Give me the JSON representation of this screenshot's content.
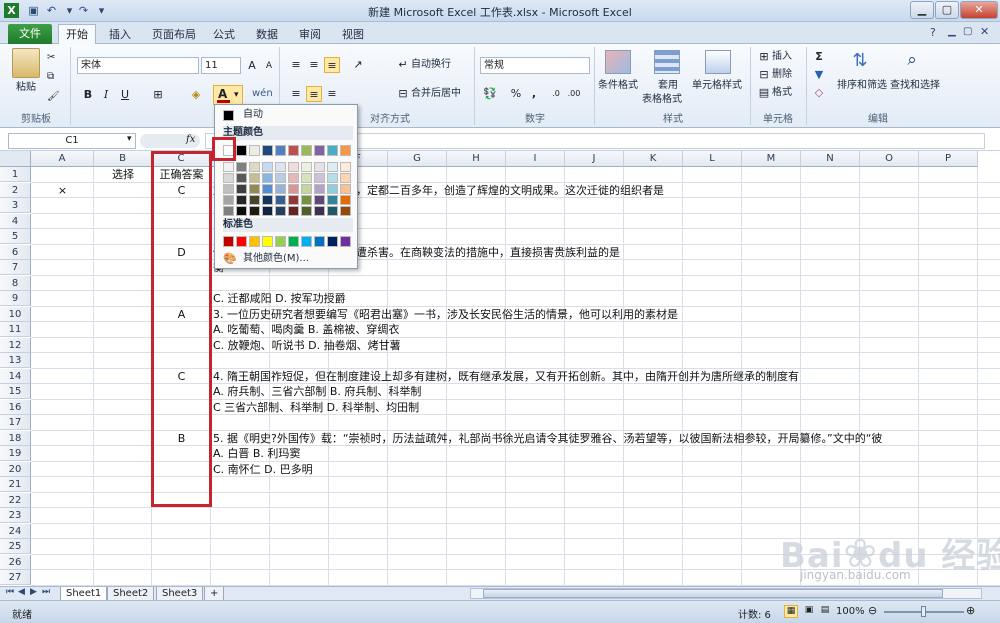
{
  "window": {
    "title": "新建 Microsoft Excel 工作表.xlsx - Microsoft Excel"
  },
  "tabs": [
    "文件",
    "开始",
    "插入",
    "页面布局",
    "公式",
    "数据",
    "审阅",
    "视图"
  ],
  "ribbon": {
    "clipboard": {
      "paste": "粘贴",
      "label": "剪贴板"
    },
    "font": {
      "name": "宋体",
      "size": "11",
      "bold": "B",
      "italic": "I",
      "underline": "U",
      "label": "字体",
      "wen": "wén"
    },
    "align": {
      "wrap": "自动换行",
      "merge": "合并后居中",
      "label": "对齐方式"
    },
    "number": {
      "format": "常规",
      "percent": "%",
      "comma": ",",
      "label": "数字"
    },
    "styles": {
      "cond": "条件格式",
      "table_1": "套用",
      "table_2": "表格格式",
      "cell": "单元格样式",
      "label": "样式"
    },
    "cells": {
      "insert": "插入",
      "delete": "删除",
      "format": "格式",
      "label": "单元格"
    },
    "edit": {
      "sum": "Σ",
      "sort": "排序和筛选",
      "find": "查找和选择",
      "label": "编辑"
    }
  },
  "formula_bar": {
    "name_box": "C1",
    "fx": "fx",
    "value": "1"
  },
  "palette": {
    "auto": "自动",
    "theme": "主题颜色",
    "standard": "标准色",
    "more": "其他颜色(M)...",
    "theme_colors": [
      "#ffffff",
      "#000000",
      "#eeece1",
      "#1f497d",
      "#4f81bd",
      "#c0504d",
      "#9bbb59",
      "#8064a2",
      "#4bacc6",
      "#f79646"
    ],
    "shades": [
      [
        "#f2f2f2",
        "#7f7f7f",
        "#ddd9c3",
        "#c6d9f0",
        "#dbe5f1",
        "#f2dcdb",
        "#ebf1dd",
        "#e5e0ec",
        "#dbeef3",
        "#fdeada"
      ],
      [
        "#d8d8d8",
        "#595959",
        "#c4bd97",
        "#8db3e2",
        "#b8cce4",
        "#e5b9b7",
        "#d7e3bc",
        "#ccc1d9",
        "#b7dde8",
        "#fbd5b5"
      ],
      [
        "#bfbfbf",
        "#3f3f3f",
        "#938953",
        "#548dd4",
        "#95b3d7",
        "#d99694",
        "#c3d69b",
        "#b2a2c7",
        "#92cddc",
        "#fac08f"
      ],
      [
        "#a5a5a5",
        "#262626",
        "#494429",
        "#17365d",
        "#366092",
        "#953734",
        "#76923c",
        "#5f497a",
        "#31859b",
        "#e36c09"
      ],
      [
        "#7f7f7f",
        "#0c0c0c",
        "#1d1b10",
        "#0f243e",
        "#244061",
        "#632423",
        "#4f6128",
        "#3f3151",
        "#205867",
        "#974806"
      ]
    ],
    "standard_colors": [
      "#c00000",
      "#ff0000",
      "#ffc000",
      "#ffff00",
      "#92d050",
      "#00b050",
      "#00b0f0",
      "#0070c0",
      "#002060",
      "#7030a0"
    ]
  },
  "columns": [
    "A",
    "B",
    "C",
    "D",
    "E",
    "F",
    "G",
    "H",
    "I",
    "J",
    "K",
    "L",
    "M",
    "N",
    "O",
    "P"
  ],
  "rows": [
    "1",
    "2",
    "3",
    "4",
    "5",
    "6",
    "7",
    "8",
    "9",
    "10",
    "11",
    "12",
    "13",
    "14",
    "15",
    "16",
    "17",
    "18",
    "19",
    "20",
    "21",
    "22",
    "23",
    "24",
    "25",
    "26",
    "27"
  ],
  "cells": {
    "b1": "选择",
    "c1": "正确答案",
    "a2": "×",
    "c2": "C",
    "c6": "D",
    "c10": "A",
    "c14": "C",
    "c18": "B",
    "d2": "族屡屡迁徙，最后一次迁徙后，定都二百多年，创造了辉煌的文明成果。这次迁徙的组织者是",
    "d3": "(",
    "d5": "(",
    "d6": "他本人却被贵族诬告谋反，惨遭杀害。在商鞅变法的措施中，直接损害贵族利益的是",
    "d7": "衡",
    "d9": "C. 迁都咸阳 D. 按军功授爵",
    "d10": "3. 一位历史研究者想要编写《昭君出塞》一书，涉及长安民俗生活的情景，他可以利用的素材是",
    "d11": "A. 吃葡萄、喝肉羹 B. 盖棉被、穿绸衣",
    "d12": "C. 放鞭炮、听说书 D. 抽卷烟、烤甘薯",
    "d14": "4. 隋王朝国祚短促，但在制度建设上却多有建树，既有继承发展，又有开拓创新。其中，由隋开创并为唐所继承的制度有",
    "d15": "A. 府兵制、三省六部制 B. 府兵制、科举制",
    "d16": "C 三省六部制、科举制 D. 科举制、均田制",
    "d18": "5. 据《明史?外国传》载：“崇祯时，历法益疏舛，礼部尚书徐光启请令其徒罗雅谷、汤若望等，以彼国新法相参较，开局纂修。”文中的“彼",
    "d19": "A. 白晋 B. 利玛窦",
    "d20": "C. 南怀仁 D. 巴多明"
  },
  "sheets": [
    "Sheet1",
    "Sheet2",
    "Sheet3"
  ],
  "status": {
    "ready": "就绪",
    "count": "计数: 6",
    "zoom": "100%"
  },
  "watermark": "Bai du 经验 jingyan.baidu.com"
}
